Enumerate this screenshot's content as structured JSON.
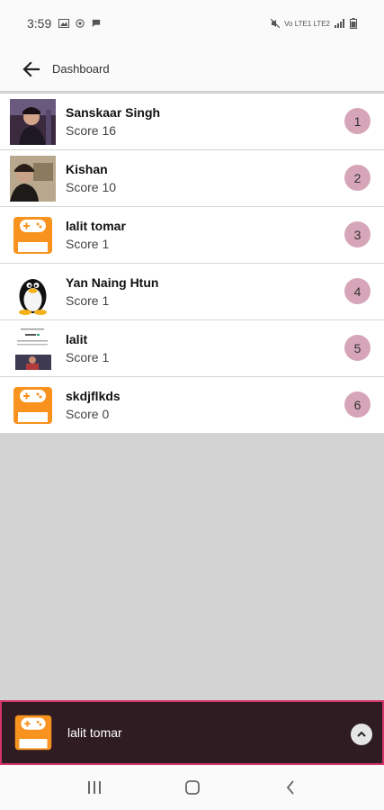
{
  "status": {
    "time": "3:59",
    "right_text": "Vo LTE1 LTE2"
  },
  "header": {
    "title": "Dashboard",
    "back_icon": "arrow-left-icon"
  },
  "players": [
    {
      "name": "Sanskaar Singh",
      "score": "Score 16",
      "rank": "1",
      "avatar": "photo"
    },
    {
      "name": "Kishan",
      "score": "Score 10",
      "rank": "2",
      "avatar": "photo"
    },
    {
      "name": "lalit tomar",
      "score": "Score 1",
      "rank": "3",
      "avatar": "code-war-logo"
    },
    {
      "name": "Yan Naing Htun",
      "score": "Score 1",
      "rank": "4",
      "avatar": "tux-penguin"
    },
    {
      "name": "lalit",
      "score": "Score 1",
      "rank": "5",
      "avatar": "screenshot"
    },
    {
      "name": "skdjflkds",
      "score": "Score 0",
      "rank": "6",
      "avatar": "code-war-logo"
    }
  ],
  "bottom_player": {
    "name": "lalit tomar",
    "toggle_icon": "chevron-up-icon"
  },
  "colors": {
    "rank_badge": "#d6a6b8",
    "bottom_bar_bg": "#2e1c22",
    "bottom_bar_border": "#d2356d",
    "logo_orange": "#f7931e"
  }
}
